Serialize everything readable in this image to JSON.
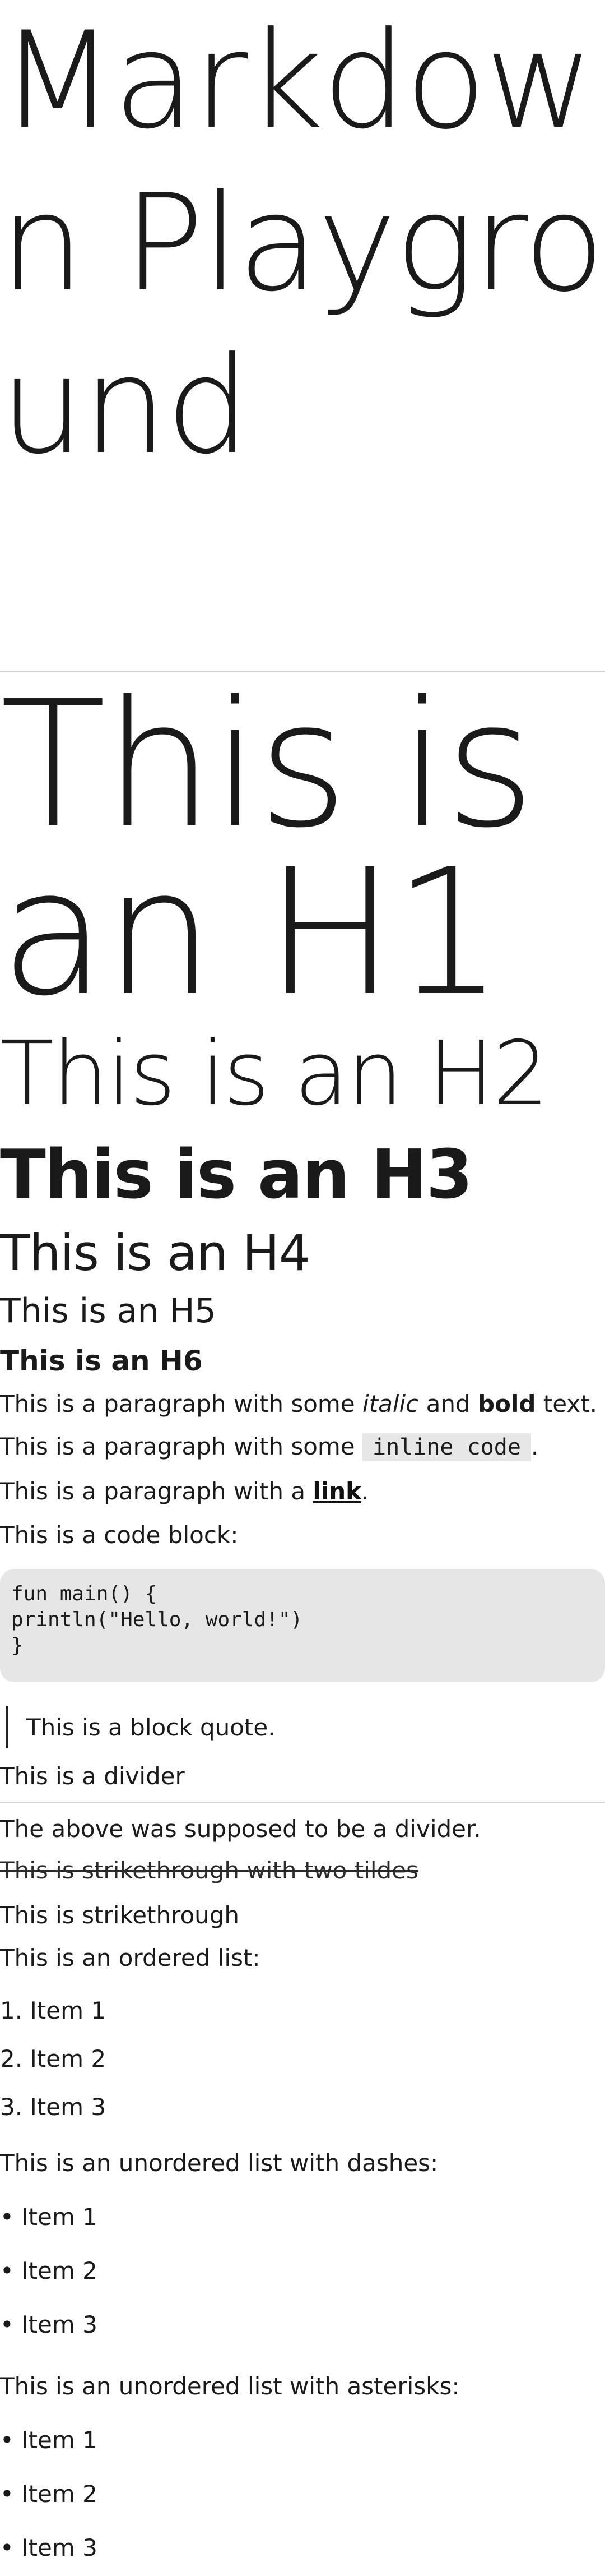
{
  "title": "Markdown Playground",
  "headings": {
    "h1": "This is an H1",
    "h2": "This is an H2",
    "h3": "This is an H3",
    "h4": "This is an H4",
    "h5": "This is an H5",
    "h6": "This is an H6"
  },
  "paragraphs": {
    "italic_prefix": "This is a paragraph with some ",
    "italic_word": "italic",
    "italic_mid": " and ",
    "bold_word": "bold",
    "italic_suffix": " text.",
    "code_prefix": "This is a paragraph with some ",
    "inline_code": "inline code",
    "code_suffix": ".",
    "link_prefix": "This is a paragraph with a ",
    "link_text": "link",
    "link_suffix": ".",
    "codeblock_label": "This is a code block:"
  },
  "code_block": {
    "lines": [
      "fun main() {",
      "println(\"Hello, world!\")",
      "}"
    ]
  },
  "blockquote": "This is a block quote.",
  "divider_label": "This is a divider",
  "after_divider": "The above was supposed to be a divider.",
  "strikethrough_tildes": "This is strikethrough with two tildes",
  "strikethrough_plain": "This is strikethrough",
  "ordered_list": {
    "label": "This is an ordered list:",
    "items": [
      "1. Item 1",
      "2. Item 2",
      "3. Item 3"
    ]
  },
  "unordered_dashes": {
    "label": "This is an unordered list with dashes:",
    "items": [
      "• Item 1",
      "• Item 2",
      "• Item 3"
    ]
  },
  "unordered_asterisks": {
    "label": "This is an unordered list with asterisks:",
    "items": [
      "• Item 1",
      "• Item 2",
      "• Item 3"
    ]
  }
}
